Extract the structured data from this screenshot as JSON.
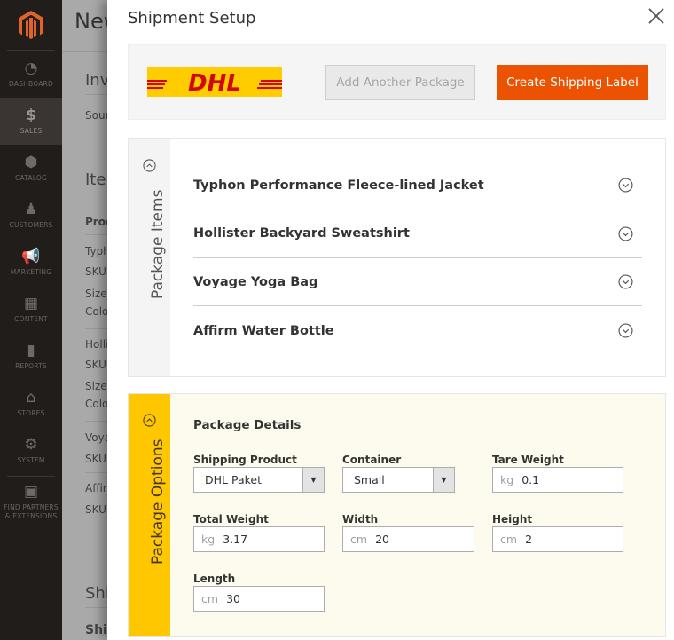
{
  "sidebar": {
    "logo": "magento-logo",
    "items": [
      {
        "label": "DASHBOARD",
        "icon": "dashboard-icon",
        "glyph": "◔",
        "active": false
      },
      {
        "label": "SALES",
        "icon": "dollar-icon",
        "glyph": "$",
        "active": true
      },
      {
        "label": "CATALOG",
        "icon": "box-icon",
        "glyph": "⬢",
        "active": false
      },
      {
        "label": "CUSTOMERS",
        "icon": "person-icon",
        "glyph": "♟",
        "active": false
      },
      {
        "label": "MARKETING",
        "icon": "megaphone-icon",
        "glyph": "📢",
        "active": false
      },
      {
        "label": "CONTENT",
        "icon": "layout-icon",
        "glyph": "▦",
        "active": false
      },
      {
        "label": "REPORTS",
        "icon": "bar-chart-icon",
        "glyph": "▮",
        "active": false
      },
      {
        "label": "STORES",
        "icon": "storefront-icon",
        "glyph": "⌂",
        "active": false
      },
      {
        "label": "SYSTEM",
        "icon": "gear-icon",
        "glyph": "⚙",
        "active": false
      },
      {
        "label": "FIND PARTNERS & EXTENSIONS",
        "icon": "blocks-icon",
        "glyph": "▣",
        "active": false
      }
    ]
  },
  "background_page": {
    "title": "New",
    "section_invoice": "Inv",
    "source_label": "Sour",
    "section_items": "Iter",
    "col_product": "Prod",
    "rows": [
      "Typh",
      "SKU:",
      "Size:",
      "Colo",
      "Hollis",
      "SKU:",
      "Size:",
      "Colo",
      "Voya",
      "SKU:",
      "Affirr",
      "SKU:"
    ],
    "section_shipping": "Shi",
    "shipping_sub": "Shi"
  },
  "modal": {
    "title": "Shipment Setup",
    "close_icon": "close-icon",
    "carrier_logo": "DHL",
    "add_package_label": "Add Another Package",
    "create_label_label": "Create Shipping Label",
    "package_items": {
      "tab_label": "Package Items",
      "items": [
        "Typhon Performance Fleece-lined Jacket",
        "Hollister Backyard Sweatshirt",
        "Voyage Yoga Bag",
        "Affirm Water Bottle"
      ]
    },
    "package_options": {
      "tab_label": "Package Options",
      "details_title": "Package Details",
      "shipping_product": {
        "label": "Shipping Product",
        "value": "DHL Paket"
      },
      "container": {
        "label": "Container",
        "value": "Small"
      },
      "tare_weight": {
        "label": "Tare Weight",
        "unit": "kg",
        "value": "0.1"
      },
      "total_weight": {
        "label": "Total Weight",
        "unit": "kg",
        "value": "3.17"
      },
      "width": {
        "label": "Width",
        "unit": "cm",
        "value": "20"
      },
      "height": {
        "label": "Height",
        "unit": "cm",
        "value": "2"
      },
      "length": {
        "label": "Length",
        "unit": "cm",
        "value": "30"
      }
    }
  },
  "colors": {
    "primary_button": "#eb5202",
    "dhl_yellow": "#ffcc00",
    "dhl_red": "#d40511",
    "options_tab": "#ffc700",
    "sidebar_bg": "#201d1b"
  }
}
